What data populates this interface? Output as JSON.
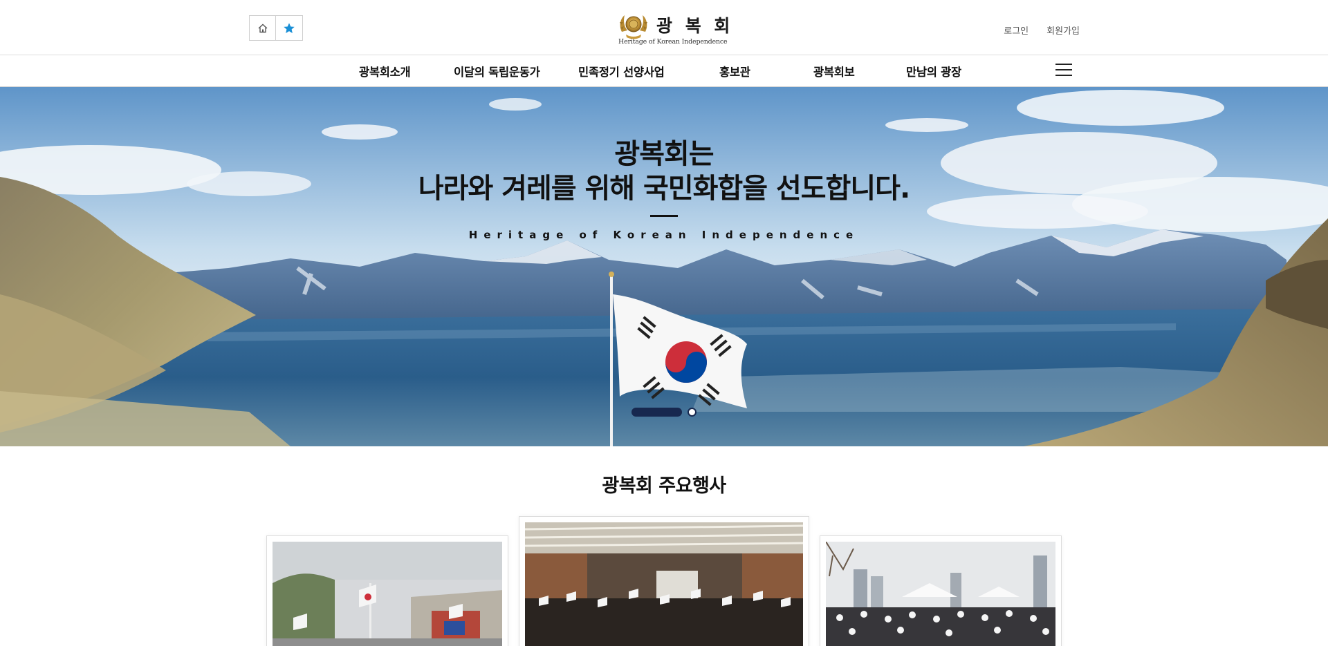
{
  "header": {
    "quick_links": [
      {
        "icon": "home-icon"
      },
      {
        "icon": "star-icon",
        "color": "#1a8fd6"
      }
    ],
    "logo": {
      "name": "광 복 회",
      "subtitle": "Heritage of Korean Independence"
    },
    "member_links": {
      "login": "로그인",
      "join": "회원가입"
    }
  },
  "gnb": {
    "items": [
      "광복회소개",
      "이달의 독립운동가",
      "민족정기 선양사업",
      "홍보관",
      "광복회보",
      "만남의 광장"
    ],
    "menu_icon": "hamburger-menu-icon"
  },
  "hero": {
    "title_line1": "광복회는",
    "title_line2": "나라와 겨레를 위해 국민화합을 선도합니다.",
    "subtitle": "Heritage of Korean Independence",
    "slides": 2,
    "active_slide": 1,
    "accent_color": "#17284f"
  },
  "events": {
    "title": "광복회 주요행사"
  }
}
